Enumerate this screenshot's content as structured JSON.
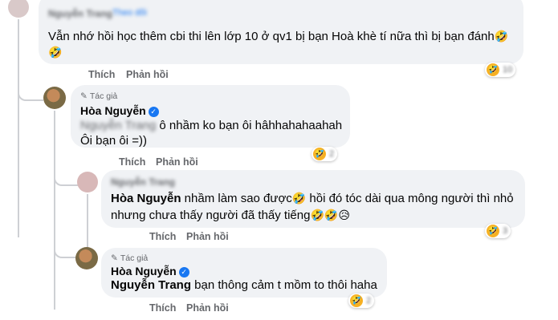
{
  "comment1": {
    "author": "Nguyễn Trang",
    "time": "Theo dõi",
    "text": "Vẫn nhớ hồi học thêm cbi thi lên lớp 10 ở qv1 bị bạn Hoà khè tí nữa thì bị bạn đánh",
    "emoji_trail": "🤣",
    "emoji_line2": "🤣",
    "like": "Thích",
    "reply": "Phản hồi",
    "reaction_emoji": "🤣",
    "reaction_count": "10"
  },
  "reply1": {
    "badge": "Tác giả",
    "author": "Hòa Nguyễn",
    "mention": "Nguyễn Trang",
    "text_line1": " ô nhầm ko bạn ôi hâhhahahaahah",
    "text_line2": "Ôi bạn ôi =))",
    "like": "Thích",
    "reply": "Phản hồi",
    "reaction_emoji": "🤣",
    "reaction_count": "2"
  },
  "reply2": {
    "author": "Nguyễn Trang",
    "mention": "Hòa Nguyễn",
    "text_a": " nhầm làm sao được",
    "text_b": " hồi đó tóc dài qua mông người thì nhỏ",
    "text_line2": "nhưng chưa thấy người đã thấy tiếng",
    "emoji1": "🤣",
    "emoji_end": "🤣🤣😥",
    "like": "Thích",
    "reply": "Phản hồi",
    "reaction_emoji": "🤣",
    "reaction_count": "3"
  },
  "reply3": {
    "badge": "Tác giả",
    "author": "Hòa Nguyễn",
    "mention": "Nguyễn Trang",
    "text": " bạn thông cảm t mồm to thôi haha",
    "like": "Thích",
    "reply": "Phản hồi",
    "reaction_emoji": "🤣",
    "reaction_count": "2"
  },
  "colors": {
    "bubble": "#f0f2f5",
    "verified": "#1877f2",
    "secondary_text": "#65676b",
    "thread_line": "#ced0d4"
  }
}
